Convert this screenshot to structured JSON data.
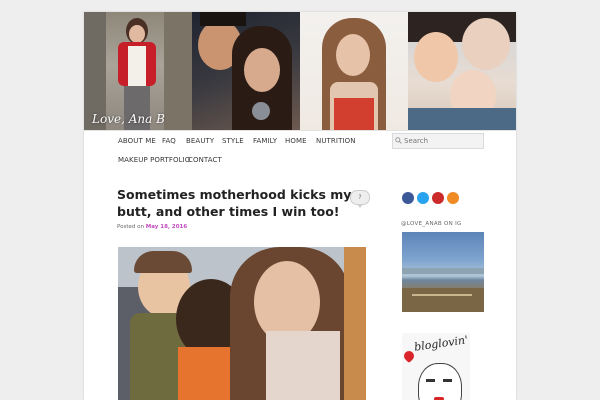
{
  "header": {
    "site_title": "Love, Ana B"
  },
  "nav": {
    "items": [
      "ABOUT ME",
      "FAQ",
      "BEAUTY",
      "STYLE",
      "FAMILY",
      "HOME",
      "NUTRITION",
      "MAKEUP PORTFOLIO",
      "CONTACT"
    ]
  },
  "search": {
    "placeholder": "Search"
  },
  "post": {
    "title": "Sometimes motherhood kicks my butt, and other times I win too!",
    "posted_on_label": "Posted on",
    "date": "May 18, 2016",
    "comment_count": "?"
  },
  "sidebar": {
    "social_icons": [
      "facebook-icon",
      "twitter-icon",
      "youtube-icon",
      "rss-icon"
    ],
    "instagram_title": "@LOVE_ANAB ON IG",
    "bloglovin_text": "bloglovin'"
  },
  "colors": {
    "date_link": "#c24bbf",
    "facebook": "#3b5998",
    "twitter": "#2aa3ef",
    "youtube": "#cc2a2a",
    "rss": "#f08a24"
  }
}
